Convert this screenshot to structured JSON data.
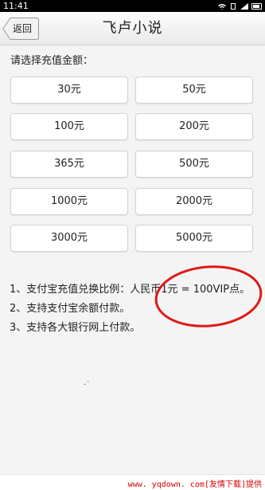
{
  "status_bar": {
    "time": "11:41",
    "icons": [
      "wifi-icon",
      "sim-icon",
      "signal-icon",
      "battery-icon"
    ]
  },
  "header": {
    "back_label": "返回",
    "title": "飞卢小说"
  },
  "prompt": "请选择充值金额：",
  "amounts": [
    "30元",
    "50元",
    "100元",
    "200元",
    "365元",
    "500元",
    "1000元",
    "2000元",
    "3000元",
    "5000元"
  ],
  "notes": [
    "1、支付宝充值兑换比例：人民币1元 = 100VIP点。",
    "2、支持支付宝余额付款。",
    "3、支持各大银行网上付款。"
  ],
  "footer": {
    "watermark": "www. yqdown. com[友情下载]提供"
  },
  "colors": {
    "annotation_circle": "#e01818",
    "watermark": "#d40000",
    "status_bar": "#000000"
  }
}
